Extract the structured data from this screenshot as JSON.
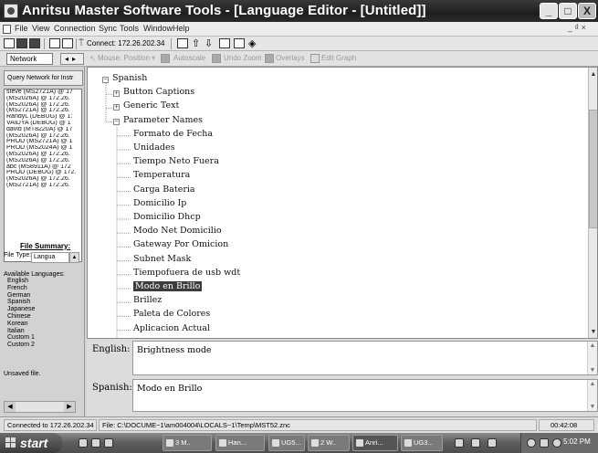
{
  "window": {
    "title": "Anritsu Master Software Tools - [Language Editor - [Untitled]]",
    "controls": {
      "minimize": "_",
      "maximize": "□",
      "close": "X"
    }
  },
  "menubar": {
    "items": [
      "File",
      "View",
      "Connection",
      "Sync",
      "Tools",
      "Window",
      "Help"
    ],
    "mdi_controls": "_ ₫ ×"
  },
  "toolbar1": {
    "connect_label": "Connect: 172.26.202.34"
  },
  "toolbar2": {
    "network_tab": "Network",
    "nav_arrows": "◂▸",
    "mouse_position": "Mouse: Position",
    "autoscale": "Autoscale",
    "undo_zoom": "Undo Zoom",
    "overlays": "Overlays",
    "edit_graph": "Edit Graph"
  },
  "left_panel": {
    "query_button": "Query Network for Instr",
    "connections": [
      "steve (MS2721A) @ 17",
      "(MS2026A) @ 172.26.",
      "(MS2026A) @ 172.26.",
      "(MS2721A) @ 172.26.",
      "RandyL (DEBUG) @ 1:",
      "VAIDYA (DEBUG) @ 1",
      "david (MT8220A) @ 17",
      "(MS2026A) @ 172.26.",
      "PROD (MS2721A) @ 1",
      "PROD (MS2024A) @ 1",
      "(MS2026A) @ 172.26.",
      "(MS2026A) @ 172.26.",
      "abc (MS8911A) @ 172",
      "PROD (DEBUG) @ 172.",
      "(MS2026A) @ 172.26.",
      "(MS2721A) @ 172.26."
    ],
    "file_summary_title": "File Summary:",
    "file_type_label": "File Type:",
    "file_type_value": "Langua",
    "available_languages_label": "Available Languages:",
    "languages": [
      "English",
      "French",
      "German",
      "Spanish",
      "Japanese",
      "Chinese",
      "Korean",
      "Italian",
      "Custom 1",
      "Custom 2"
    ],
    "unsaved": "Unsaved file."
  },
  "tree": {
    "root": "Spanish",
    "groups": [
      "Button Captions",
      "Generic Text",
      "Parameter Names"
    ],
    "items": [
      "Formato de Fecha",
      "Unidades",
      "Tiempo Neto Fuera",
      "Temperatura",
      "Carga Bateria",
      "Domicilio Ip",
      "Domicilio Dhcp",
      "Modo Net Domicilio",
      "Gateway Por Omicion",
      "Subnet Mask",
      "Tiempofuera de usb wdt",
      "Modo en Brillo",
      "Brillez",
      "Paleta de Colores",
      "Aplicacion Actual"
    ],
    "selected_index": 11
  },
  "editor": {
    "english_label": "English:",
    "english_value": "Brightness mode",
    "spanish_label": "Spanish:",
    "spanish_value": "Modo en Brillo"
  },
  "statusbar": {
    "connection": "Connected to 172.26.202.34",
    "file_path": "File: C:\\DOCUME~1\\am004004\\LOCALS~1\\Temp\\MST52.znc",
    "elapsed": "00:42:08"
  },
  "taskbar": {
    "start": "start",
    "tasks": [
      "3 M..",
      "Han...",
      "UG5...",
      "2 W..",
      "Anri...",
      "UG3..."
    ],
    "clock": "5:02 PM"
  }
}
